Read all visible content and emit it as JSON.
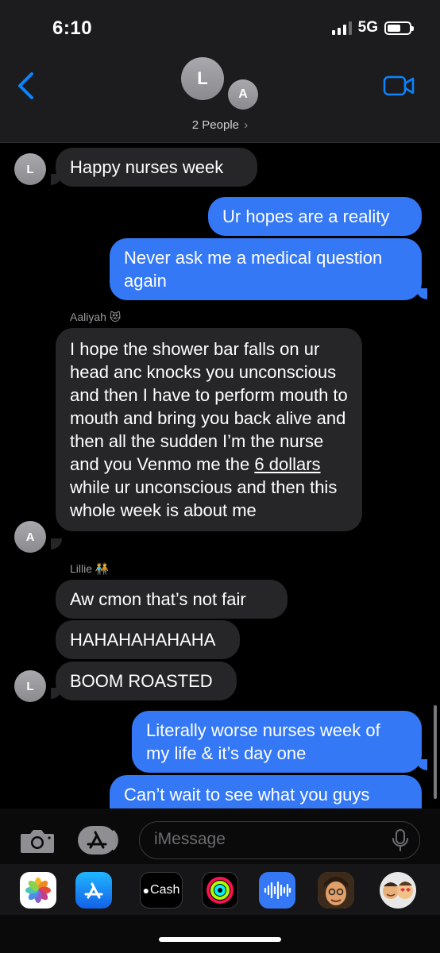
{
  "status": {
    "time": "6:10",
    "network": "5G"
  },
  "header": {
    "avatars": [
      "L",
      "A"
    ],
    "people_label": "2 People",
    "chevron": "›"
  },
  "messages": [
    {
      "dir": "in",
      "text": "Happy nurses week",
      "avatar": "L"
    },
    {
      "dir": "out",
      "text": "Ur hopes are a reality"
    },
    {
      "dir": "out",
      "text": "Never ask me a medical question again"
    },
    {
      "dir": "in",
      "sender": "Aaliyah 😻",
      "avatar": "A",
      "text_before_link": "I hope the shower bar falls on ur head anc knocks you unconscious and then I have to perform mouth to mouth and bring you back alive and then all the sudden I’m the nurse and you Venmo me the ",
      "link": "6 dollars",
      "text_after_link": " while ur unconscious and then this whole week is about me"
    },
    {
      "dir": "in",
      "sender": "Lillie 🧑‍🤝‍🧑",
      "text": "Aw cmon that’s not fair"
    },
    {
      "dir": "in",
      "text": "HAHAHAHAHAHA"
    },
    {
      "dir": "in",
      "text": "BOOM ROASTED",
      "avatar": "L"
    },
    {
      "dir": "out",
      "text": "Literally worse nurses week of my life & it’s day one"
    },
    {
      "dir": "out",
      "text": "Can’t wait to see what you guys wear td since now i won’t allow u"
    }
  ],
  "input": {
    "placeholder": "iMessage"
  },
  "app_tray": [
    {
      "name": "photos",
      "icon": "photos-icon"
    },
    {
      "name": "app-store",
      "icon": "app-store-icon"
    },
    {
      "name": "cash",
      "label": "Cash",
      "icon": "cash-icon"
    },
    {
      "name": "activity",
      "icon": "activity-icon"
    },
    {
      "name": "audio",
      "icon": "waveform-icon"
    },
    {
      "name": "memoji",
      "icon": "memoji-icon"
    },
    {
      "name": "memoji-stickers",
      "icon": "memoji-stickers-icon"
    }
  ],
  "colors": {
    "outgoing": "#3478f6",
    "incoming": "#262628",
    "accent": "#0a84ff"
  }
}
